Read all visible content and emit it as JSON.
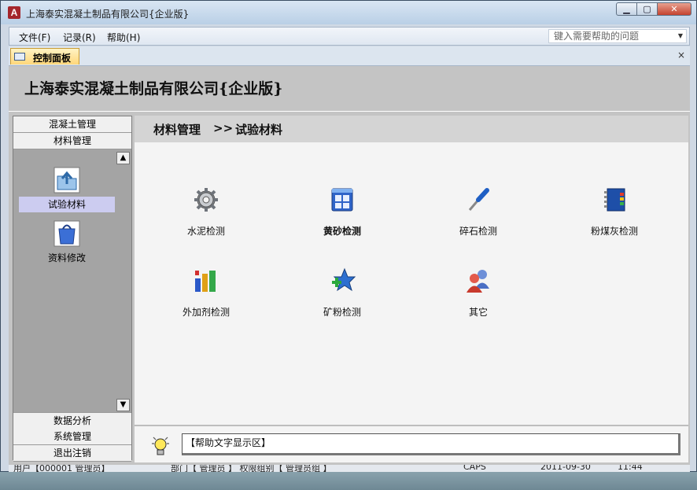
{
  "window": {
    "title": "上海泰实混凝土制品有限公司{企业版}",
    "app_icon": "A"
  },
  "menu": {
    "items": [
      "文件(F)",
      "记录(R)",
      "帮助(H)"
    ],
    "help_placeholder": "键入需要帮助的问题"
  },
  "tab": {
    "label": "控制面板",
    "close": "×"
  },
  "header": {
    "company": "上海泰实混凝土制品有限公司{企业版}"
  },
  "nav": {
    "top": [
      "混凝土管理",
      "材料管理"
    ],
    "items": [
      {
        "label": "试验材料",
        "icon": "folder-upload-icon",
        "selected": true
      },
      {
        "label": "资料修改",
        "icon": "shopping-bag-icon",
        "selected": false
      }
    ],
    "bottom": [
      "数据分析",
      "系统管理",
      "退出注销"
    ],
    "scroll_up": "▲",
    "scroll_down": "▼"
  },
  "breadcrumb": {
    "section": "材料管理",
    "sep": ">>",
    "page": "试验材料"
  },
  "items": [
    {
      "label": "水泥检测",
      "icon": "gear-icon",
      "bold": false
    },
    {
      "label": "黄砂检测",
      "icon": "window-grid-icon",
      "bold": true
    },
    {
      "label": "碎石检测",
      "icon": "screwdriver-icon",
      "bold": false
    },
    {
      "label": "粉煤灰检测",
      "icon": "notebook-icon",
      "bold": false
    },
    {
      "label": "外加剂检测",
      "icon": "bar-chart-icon",
      "bold": false
    },
    {
      "label": "矿粉检测",
      "icon": "star-plus-icon",
      "bold": false
    },
    {
      "label": "其它",
      "icon": "users-icon",
      "bold": false
    }
  ],
  "help": {
    "text": "【帮助文字显示区】",
    "icon": "lightbulb-icon"
  },
  "status": {
    "user": "用户【000001 管理员】",
    "dept": "部门【 管理员 】 权限组别【 管理员组 】",
    "caps": "CAPS",
    "date": "2011-09-30",
    "time": "11:44"
  }
}
